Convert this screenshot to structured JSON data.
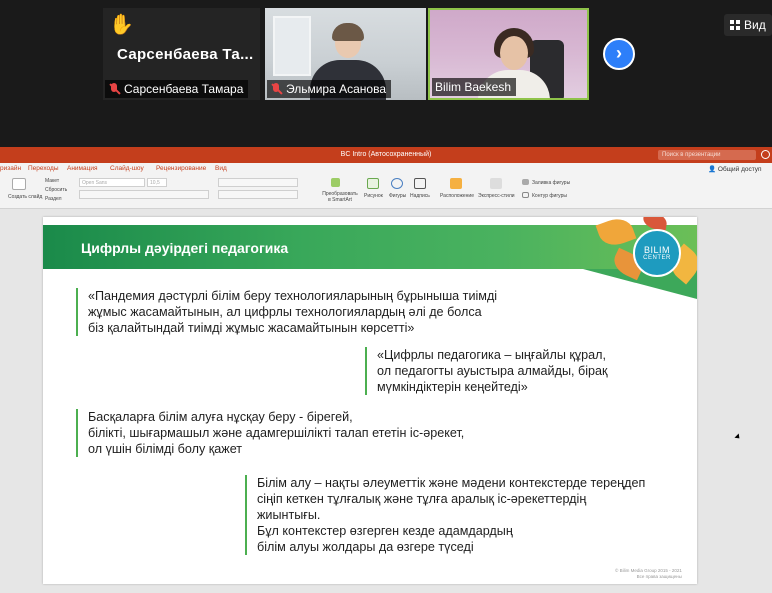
{
  "zoom": {
    "participants": [
      {
        "name": "Сарсенбаева Тамара",
        "display_name": "Сарсенбаева  Та...",
        "raised_hand": true,
        "muted": true
      },
      {
        "name": "Эльмира Асанова",
        "muted": true
      },
      {
        "name": "Bilim Baekesh",
        "muted": false,
        "active_speaker": true
      }
    ],
    "next_label": "›",
    "view_label": "Вид"
  },
  "ppt": {
    "doc_title": "BC Intro (Автосохраненный)",
    "search_placeholder": "Поиск в презентации",
    "menu": [
      "ризайн",
      "Переходы",
      "Анимация",
      "Слайд-шоу",
      "Рецензирование",
      "Вид"
    ],
    "share_label": "Общий доступ",
    "ribbon": {
      "create_slide": "Создать слайд",
      "layout": "Макет",
      "reset": "Сбросить",
      "section": "Раздел",
      "font_name": "Open Sans",
      "font_size": "10,5",
      "convert_smartart": "Преобразовать в SmartArt",
      "picture": "Рисунок",
      "shapes": "Фигуры",
      "textbox": "Надпись",
      "arrange": "Расположение",
      "quick_styles": "Экспресс-стили",
      "shape_fill": "Заливка фигуры",
      "shape_outline": "Контур фигуры"
    },
    "slide": {
      "title": "Цифрлы дәуірдегі педагогика",
      "logo_line1": "BILIM",
      "logo_line2": "CENTER",
      "blocks": [
        {
          "lines": [
            "«Пандемия дәстүрлі білім беру технологияларының бұрыныша тиімді",
            "жұмыс жасамайтынын, ал цифрлы технологиялардың әлі де болса",
            "біз қалайтындай тиімді жұмыс жасамайтынын көрсетті»"
          ]
        },
        {
          "lines": [
            "«Цифрлы педагогика – ыңғайлы құрал,",
            "ол педагогты ауыстыра алмайды, бірақ",
            "мүмкіндіктерін кеңейтеді»"
          ]
        },
        {
          "lines": [
            "Басқаларға білім алуға нұсқау беру - бірегей,",
            "білікті, шығармашыл және адамгершілікті талап ететін іс-әрекет,",
            "ол үшін білімді болу қажет"
          ]
        },
        {
          "lines": [
            "Білім алу – нақты әлеуметтік және мәдени контекстерде тереңдеп",
            "сіңіп кеткен тұлғалық және тұлға аралық іс-әрекеттердің",
            "жиынтығы.",
            "Бұл контекстер өзгерген кезде адамдардың",
            "білім алуы жолдары да өзгере түседі"
          ]
        }
      ],
      "footnote1": "© Bilim Media Group 2015 - 2021",
      "footnote2": "Все права защищены"
    }
  }
}
